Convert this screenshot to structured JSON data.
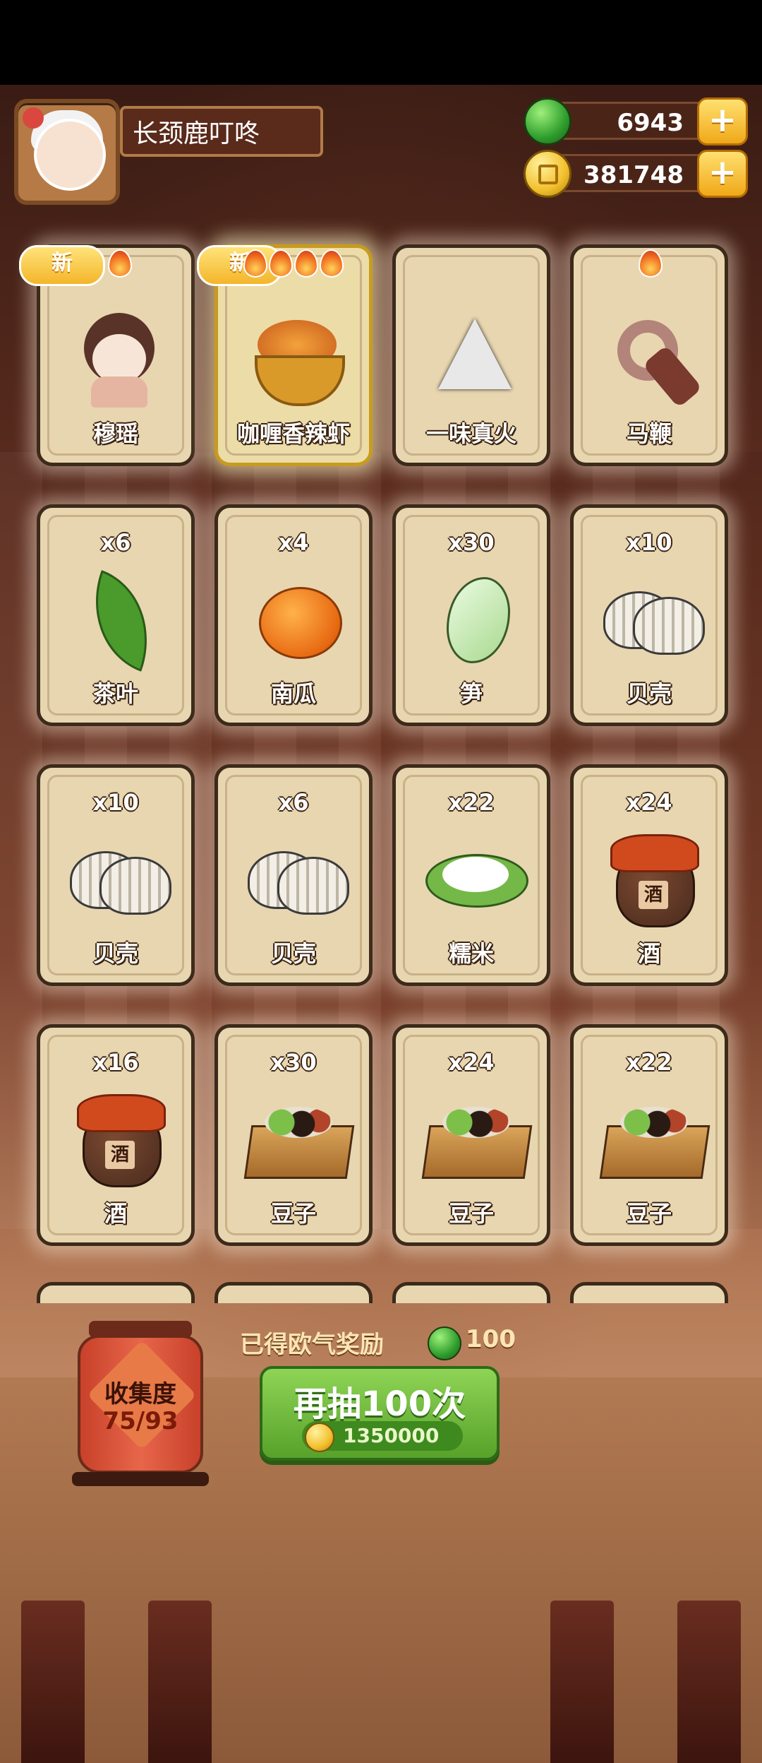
{
  "player": {
    "name": "长颈鹿叮咚"
  },
  "resources": {
    "gems": "6943",
    "coins": "381748",
    "colors": {
      "gem": "#2f9e2d",
      "coin": "#f2c02d",
      "plus": "#f0a818"
    }
  },
  "cards": [
    {
      "label": "穆瑶",
      "count": "",
      "new": "新",
      "flames": 1,
      "art": "girl-character"
    },
    {
      "label": "咖喱香辣虾",
      "count": "",
      "new": "新",
      "flames": 4,
      "art": "curry-dish"
    },
    {
      "label": "一味真火",
      "count": "",
      "new": "",
      "flames": 0,
      "art": "triangle-emblem"
    },
    {
      "label": "马鞭",
      "count": "",
      "new": "",
      "flames": 1,
      "art": "whip"
    },
    {
      "label": "茶叶",
      "count": "x6",
      "art": "tea-leaf"
    },
    {
      "label": "南瓜",
      "count": "x4",
      "art": "pumpkin"
    },
    {
      "label": "笋",
      "count": "x30",
      "art": "bamboo-shoot"
    },
    {
      "label": "贝壳",
      "count": "x10",
      "art": "shell"
    },
    {
      "label": "贝壳",
      "count": "x10",
      "art": "shell"
    },
    {
      "label": "贝壳",
      "count": "x6",
      "art": "shell"
    },
    {
      "label": "糯米",
      "count": "x22",
      "art": "sticky-rice"
    },
    {
      "label": "酒",
      "count": "x24",
      "art": "wine-jar"
    },
    {
      "label": "酒",
      "count": "x16",
      "art": "wine-jar"
    },
    {
      "label": "豆子",
      "count": "x30",
      "art": "bean-box"
    },
    {
      "label": "豆子",
      "count": "x24",
      "art": "bean-box"
    },
    {
      "label": "豆子",
      "count": "x22",
      "art": "bean-box"
    }
  ],
  "jar_tag": "酒",
  "collection": {
    "title": "收集度",
    "progress": "75/93"
  },
  "luck_reward": {
    "label": "已得欧气奖励",
    "amount": "100"
  },
  "redraw": {
    "label": "再抽100次",
    "cost": "1350000"
  }
}
